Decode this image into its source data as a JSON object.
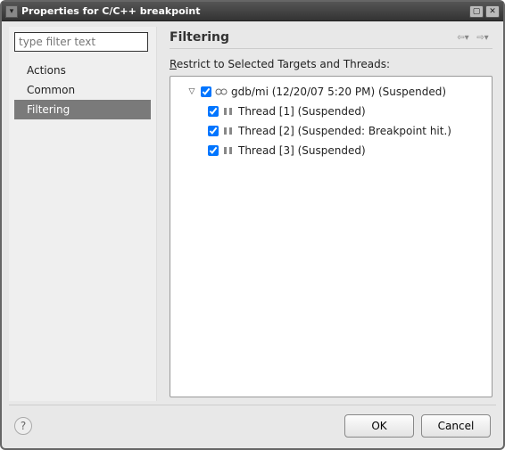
{
  "window": {
    "title": "Properties for C/C++ breakpoint"
  },
  "sidebar": {
    "filter_placeholder": "type filter text",
    "items": [
      {
        "label": "Actions"
      },
      {
        "label": "Common"
      },
      {
        "label": "Filtering"
      }
    ],
    "selected_index": 2
  },
  "content": {
    "title": "Filtering",
    "restrict_prefix": "R",
    "restrict_rest": "estrict to Selected Targets and Threads:",
    "nav_back": "⇦",
    "nav_fwd": "⇨"
  },
  "tree": {
    "root": {
      "expanded": true,
      "checked": true,
      "label": "gdb/mi (12/20/07 5:20 PM) (Suspended)"
    },
    "threads": [
      {
        "checked": true,
        "label": "Thread [1] (Suspended)"
      },
      {
        "checked": true,
        "label": "Thread [2] (Suspended: Breakpoint hit.)"
      },
      {
        "checked": true,
        "label": "Thread [3] (Suspended)"
      }
    ]
  },
  "footer": {
    "help": "?",
    "ok": "OK",
    "cancel": "Cancel"
  },
  "titlebar_controls": {
    "maximize": "▢",
    "close": "✕",
    "app": "▾"
  }
}
